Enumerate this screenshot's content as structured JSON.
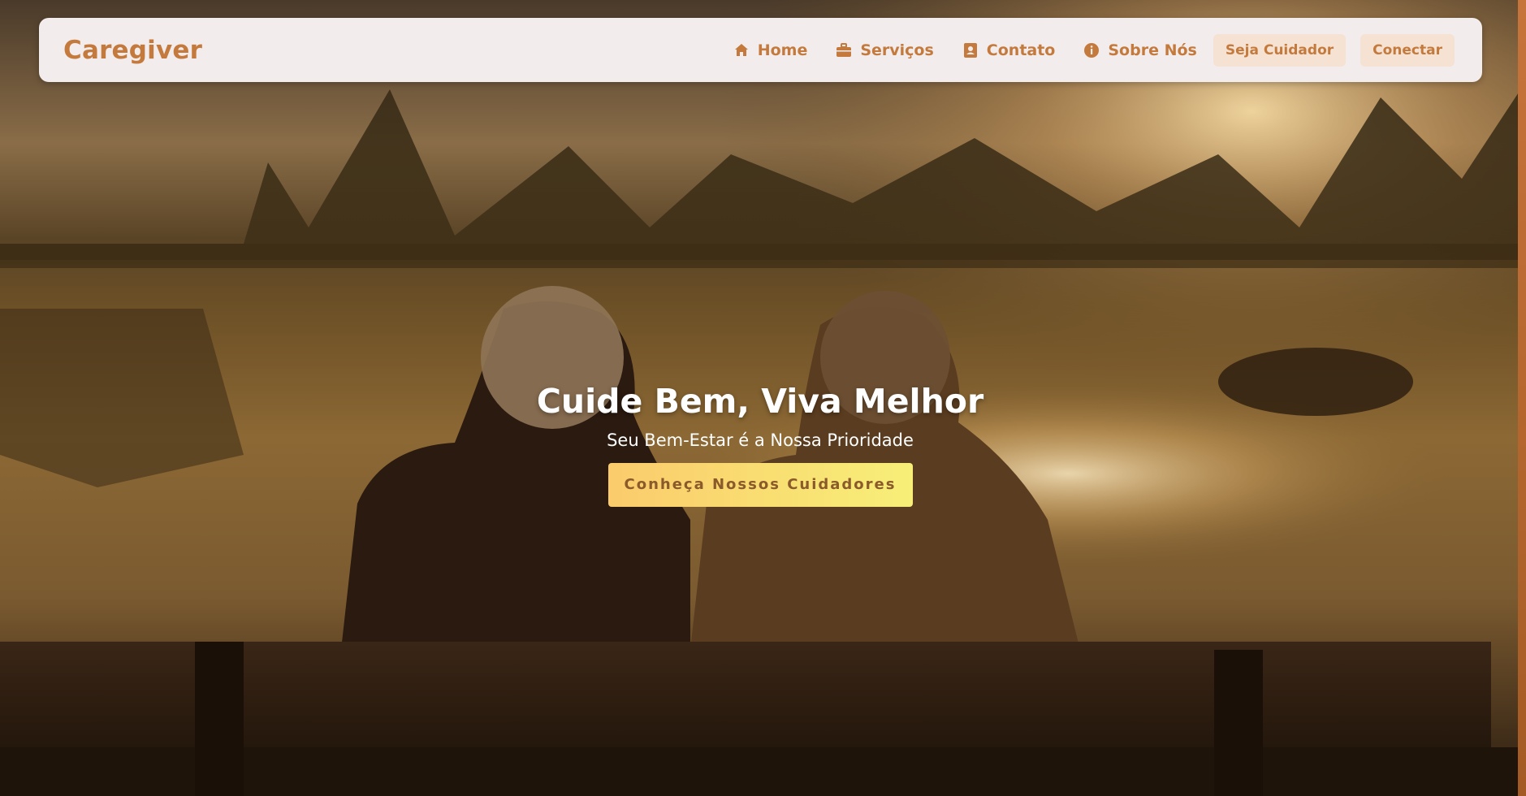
{
  "brand": {
    "name": "Caregiver",
    "color": "#c47a3d"
  },
  "nav": {
    "links": [
      {
        "label": "Home",
        "icon": "home-icon"
      },
      {
        "label": "Serviços",
        "icon": "briefcase-icon"
      },
      {
        "label": "Contato",
        "icon": "contact-card-icon"
      },
      {
        "label": "Sobre Nós",
        "icon": "info-circle-icon"
      }
    ],
    "buttons": [
      {
        "label": "Seja Cuidador"
      },
      {
        "label": "Conectar"
      }
    ]
  },
  "hero": {
    "title": "Cuide Bem, Viva Melhor",
    "subtitle": "Seu Bem-Estar é a Nossa Prioridade",
    "cta_label": "Conheça Nossos Cuidadores",
    "background": "sunset lake, elderly couple on bench",
    "cta_gradient": [
      "#fbcb6c",
      "#f7ef78"
    ]
  }
}
